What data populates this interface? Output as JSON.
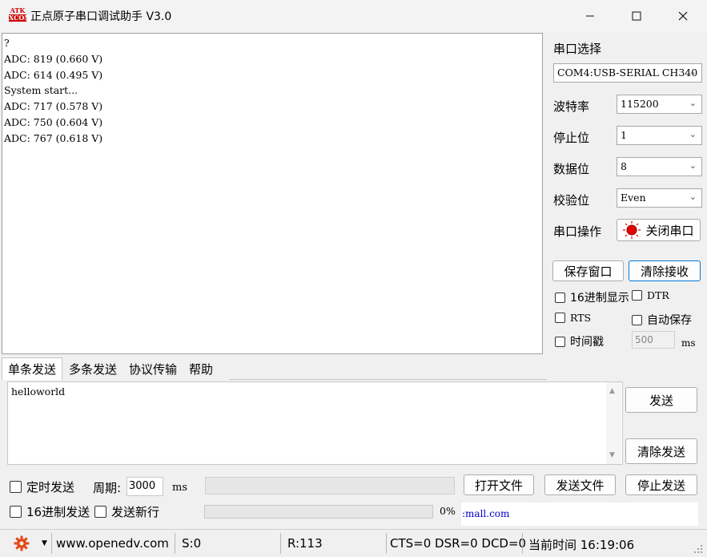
{
  "window": {
    "logo_top": "ATK",
    "logo_bottom": "XCOM",
    "title": "正点原子串口调试助手 V3.0"
  },
  "receive": {
    "lines": [
      "?",
      "ADC: 819 (0.660 V)",
      "ADC: 614 (0.495 V)",
      "System start...",
      "ADC: 717 (0.578 V)",
      "ADC: 750 (0.604 V)",
      "ADC: 767 (0.618 V)"
    ]
  },
  "settings": {
    "port_select_label": "串口选择",
    "port_value": "COM4:USB-SERIAL CH340",
    "baud_label": "波特率",
    "baud_value": "115200",
    "stopbits_label": "停止位",
    "stopbits_value": "1",
    "databits_label": "数据位",
    "databits_value": "8",
    "parity_label": "校验位",
    "parity_value": "Even",
    "port_op_label": "串口操作",
    "close_port_label": "关闭串口",
    "save_window_label": "保存窗口",
    "clear_recv_label": "清除接收",
    "hex_display_label": "16进制显示",
    "dtr_label": "DTR",
    "rts_label": "RTS",
    "auto_save_label": "自动保存",
    "timestamp_label": "时间戳",
    "timestamp_value": "500",
    "timestamp_unit": "ms"
  },
  "tabs": [
    "单条发送",
    "多条发送",
    "协议传输",
    "帮助"
  ],
  "send": {
    "text": "helloworld",
    "send_label": "发送",
    "clear_send_label": "清除发送",
    "timed_send_label": "定时发送",
    "period_label": "周期:",
    "period_value": "3000",
    "period_unit": "ms",
    "open_file_label": "打开文件",
    "send_file_label": "发送文件",
    "stop_send_label": "停止发送",
    "hex_send_label": "16进制发送",
    "newline_label": "发送新行",
    "progress_text": "0%",
    "progress": 0,
    "link_text": ":mall.com"
  },
  "status": {
    "website": "www.openedv.com",
    "sent": "S:0",
    "received": "R:113",
    "lines": "CTS=0 DSR=0 DCD=0",
    "time": "当前时间 16:19:06"
  },
  "colors": {
    "accent": "#0078d7",
    "port_open_led": "#e60000",
    "link": "#0000cc"
  }
}
